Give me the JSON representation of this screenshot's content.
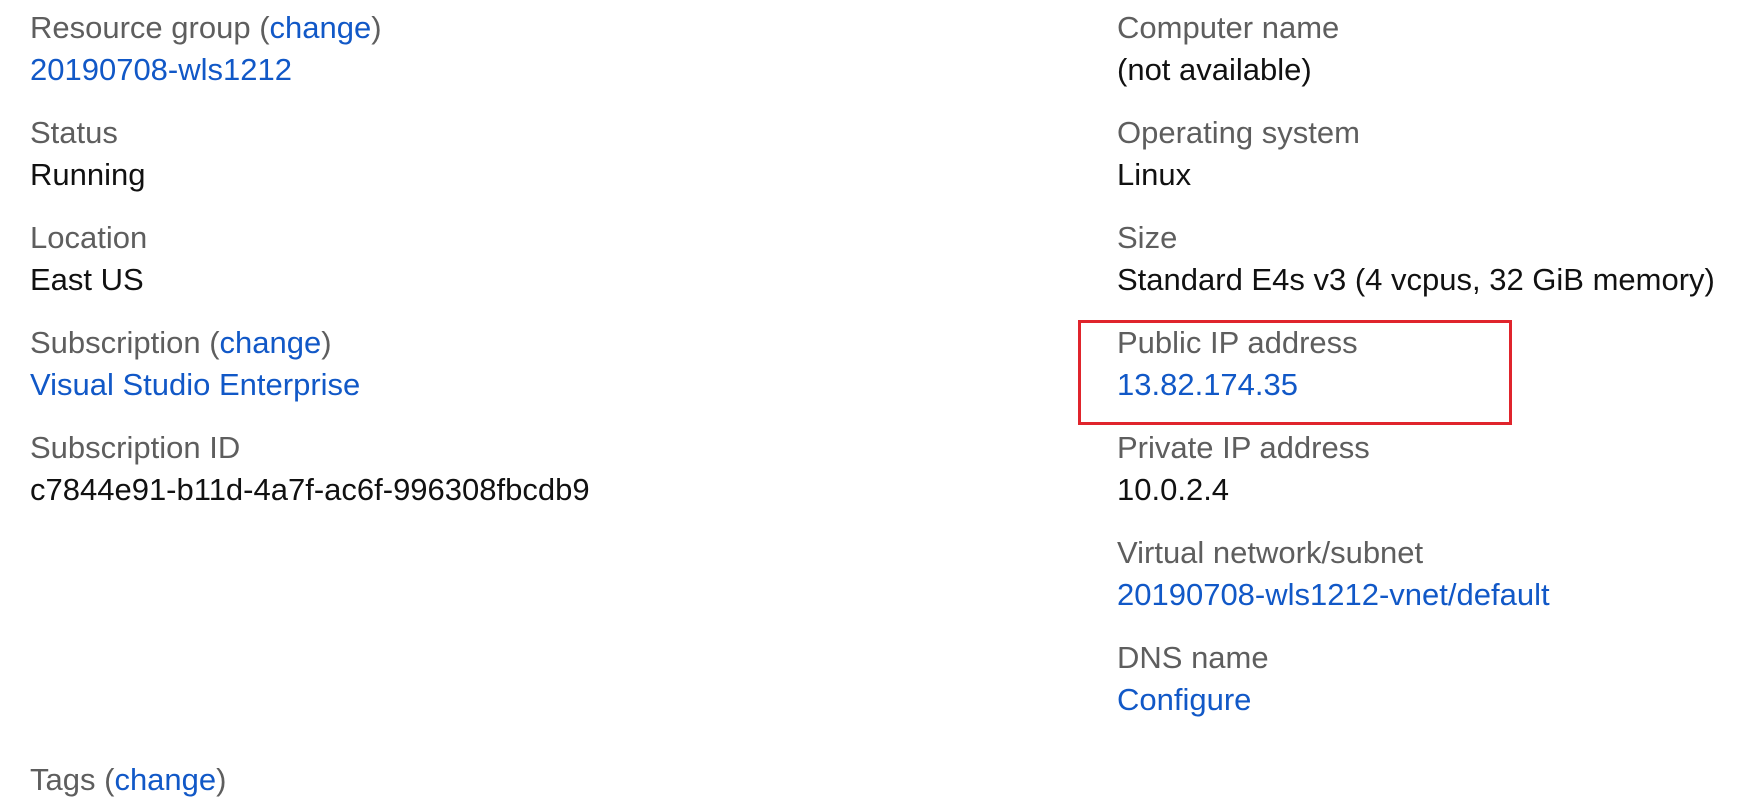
{
  "left_column": {
    "resource_group": {
      "label": "Resource group",
      "change_label": "change",
      "value": "20190708-wls1212"
    },
    "status": {
      "label": "Status",
      "value": "Running"
    },
    "location": {
      "label": "Location",
      "value": "East US"
    },
    "subscription": {
      "label": "Subscription",
      "change_label": "change",
      "value": "Visual Studio Enterprise"
    },
    "subscription_id": {
      "label": "Subscription ID",
      "value": "c7844e91-b11d-4a7f-ac6f-996308fbcdb9"
    }
  },
  "right_column": {
    "computer_name": {
      "label": "Computer name",
      "value": "(not available)"
    },
    "operating_system": {
      "label": "Operating system",
      "value": "Linux"
    },
    "size": {
      "label": "Size",
      "value": "Standard E4s v3 (4 vcpus, 32 GiB memory)"
    },
    "public_ip": {
      "label": "Public IP address",
      "value": "13.82.174.35"
    },
    "private_ip": {
      "label": "Private IP address",
      "value": "10.0.2.4"
    },
    "vnet": {
      "label": "Virtual network/subnet",
      "value": "20190708-wls1212-vnet/default"
    },
    "dns": {
      "label": "DNS name",
      "value": "Configure"
    }
  },
  "tags": {
    "label": "Tags",
    "change_label": "change"
  },
  "colors": {
    "link": "#1158c7",
    "label": "#5e5e5e",
    "value": "#111111",
    "highlight": "#e0242c"
  }
}
